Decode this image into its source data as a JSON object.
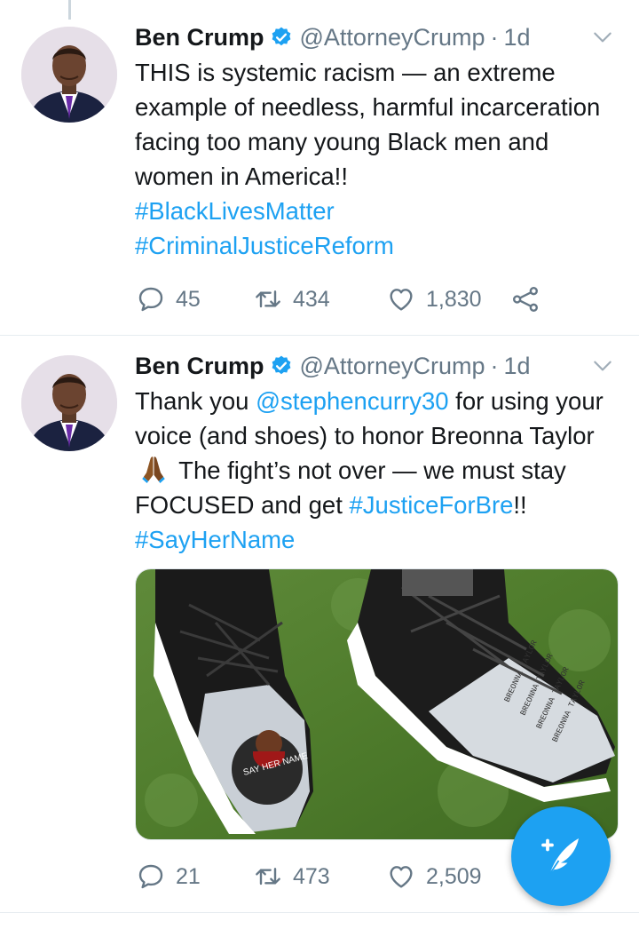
{
  "colors": {
    "accent": "#1da1f2",
    "text": "#14171a",
    "muted": "#657786",
    "divider": "#e6ecf0"
  },
  "tweets": [
    {
      "author": {
        "name": "Ben Crump",
        "handle": "@AttorneyCrump",
        "time": "1d",
        "verified": true
      },
      "text": {
        "body": "THIS is systemic racism — an extreme example of needless, harmful incarceration facing too many young Black men and women in America!!",
        "hashtag1": "#BlackLivesMatter",
        "hashtag2": "#CriminalJusticeReform"
      },
      "stats": {
        "replies": "45",
        "retweets": "434",
        "likes": "1,830"
      }
    },
    {
      "author": {
        "name": "Ben Crump",
        "handle": "@AttorneyCrump",
        "time": "1d",
        "verified": true
      },
      "text": {
        "part1": "Thank you ",
        "mention": "@stephencurry30",
        "part2": " for using your voice (and shoes) to honor Breonna Taylor",
        "emoji": "folded-hands-emoji",
        "part3": " The fight’s not over — we must stay FOCUSED and get ",
        "hashtag1": "#JusticeForBre",
        "part4": "!!",
        "hashtag2": "#SayHerName"
      },
      "media": {
        "shoe_text": "SAY HER NAME"
      },
      "stats": {
        "replies": "21",
        "retweets": "473",
        "likes": "2,509"
      }
    }
  ],
  "compose_button": {
    "icon": "compose-feather-icon"
  }
}
